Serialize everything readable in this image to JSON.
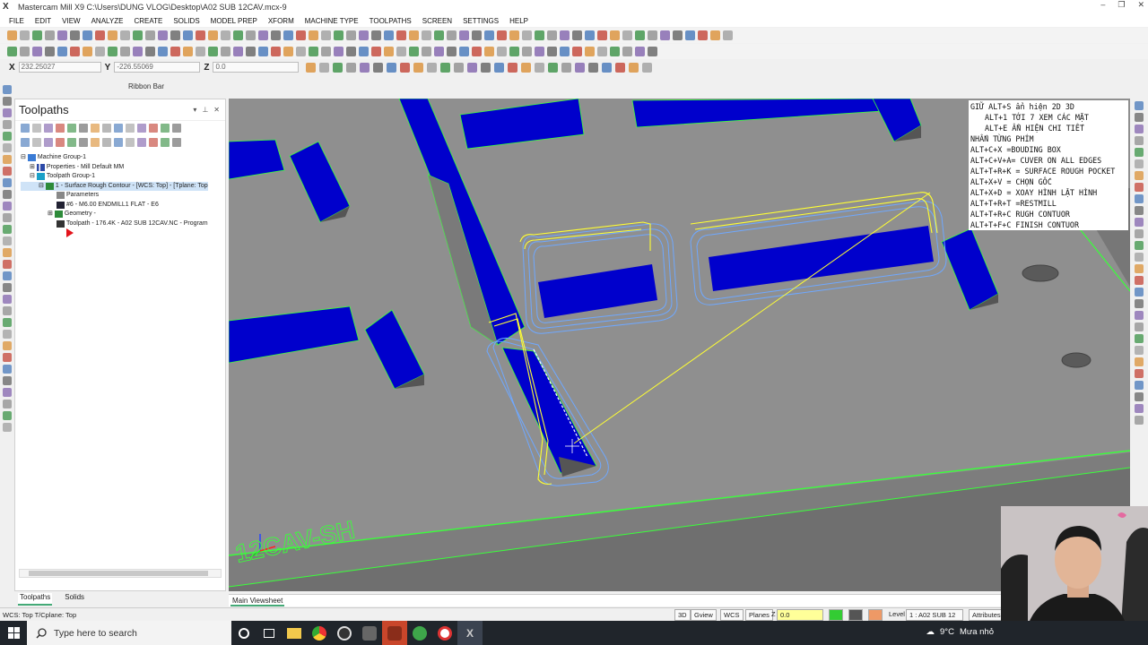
{
  "window": {
    "title": "Mastercam Mill X9  C:\\Users\\DUNG VLOG\\Desktop\\A02 SUB 12CAV.mcx-9",
    "app_icon": "mastercam-logo-icon"
  },
  "menu": [
    "FILE",
    "EDIT",
    "VIEW",
    "ANALYZE",
    "CREATE",
    "SOLIDS",
    "MODEL PREP",
    "XFORM",
    "MACHINE TYPE",
    "TOOLPATHS",
    "SCREEN",
    "SETTINGS",
    "HELP"
  ],
  "coords": {
    "x_label": "X",
    "x_value": "232.25027",
    "y_label": "Y",
    "y_value": "-226.55069",
    "z_label": "Z",
    "z_value": "0.0"
  },
  "ribbon_bar": "Ribbon Bar",
  "toolpath_manager": {
    "title": "Toolpaths",
    "tree": [
      {
        "text": "Machine Group-1",
        "level": 0
      },
      {
        "text": "Properties - Mill Default MM",
        "level": 1
      },
      {
        "text": "Toolpath Group-1",
        "level": 1
      },
      {
        "text": "1 - Surface Rough Contour - [WCS: Top] - [Tplane: Top",
        "level": 2
      },
      {
        "text": "Parameters",
        "level": 3
      },
      {
        "text": "#6 - M6.00 ENDMILL1 FLAT - E6",
        "level": 3
      },
      {
        "text": "Geometry -",
        "level": 3
      },
      {
        "text": "Toolpath - 176.4K - A02 SUB 12CAV.NC - Program",
        "level": 3
      }
    ],
    "tabs": [
      "Toolpaths",
      "Solids"
    ]
  },
  "viewport": {
    "sheet_tab": "Main Viewsheet",
    "engraving": "12CAV-SH",
    "notes": [
      "GIỮ ALT+S ẩn hiện 2D 3D",
      "  ALT+1 TỚI 7 XEM CÁC MẶT",
      "  ALT+E ẨN HIỆN CHI TIẾT",
      "NHẤN TỪNG PHÍM",
      "ALT+C+X =BOUDING BOX",
      "ALT+C+V+A= CUVER ON ALL EDGES",
      "ALT+T+R+K = SURFACE ROUGH POCKET",
      "ALT+X+V = CHỌN GỐC",
      "ALT+X+D = XOAY HÌNH LẬT HÌNH",
      "ALT+T+R+T =RESTMILL",
      "ALT+T+R+C RUGH CONTUOR",
      "ALT+T+F+C FINISH CONTUOR"
    ]
  },
  "status": {
    "left": "WCS: Top  T/Cplane: Top",
    "btn_3d": "3D",
    "btn_gview": "Gview",
    "btn_wcs": "WCS",
    "btn_planes": "Planes",
    "z_label": "Z",
    "z_value": "0.0",
    "level_label": "Level",
    "level_value": "1 : A02 SUB 12",
    "attributes": "Attributes"
  },
  "taskbar": {
    "search_placeholder": "Type here to search",
    "weather_temp": "9°C",
    "weather_text": "Mưa nhỏ",
    "colors": {
      "taskbar": "#20252b",
      "accent": "#1e6fd0"
    }
  }
}
